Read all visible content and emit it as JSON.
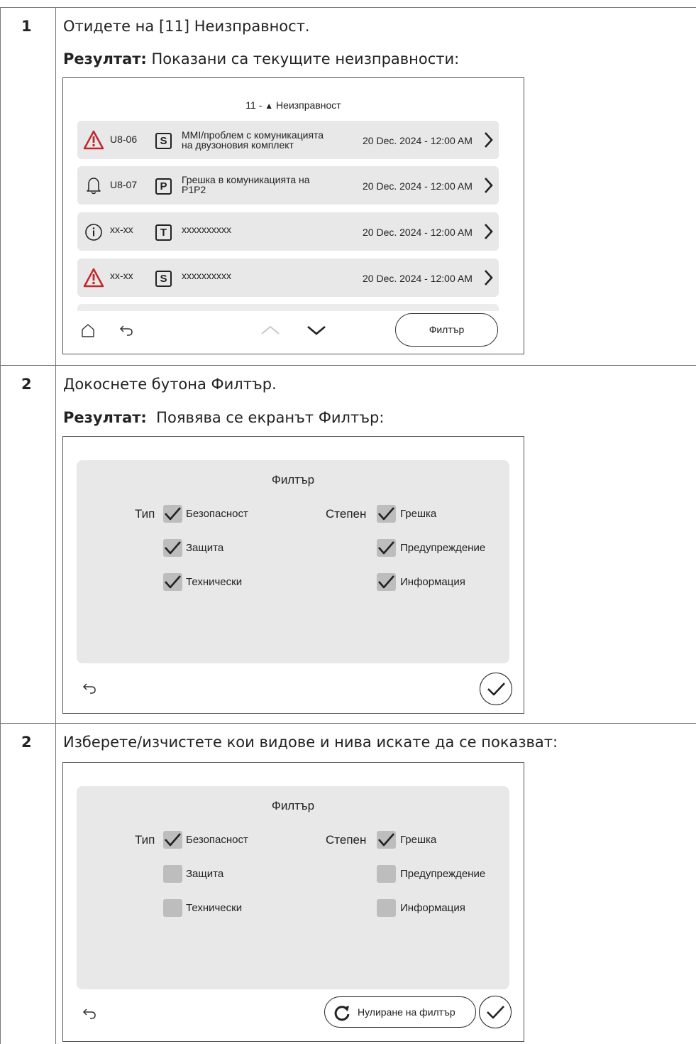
{
  "steps": [
    {
      "number": "1",
      "instruction_prefix": "Отидете на [11] ",
      "instruction_bold": "Неизправност",
      "instruction_suffix": ".",
      "result_label": "Резултат:",
      "result_text": " Показани са текущите неизправности:"
    },
    {
      "number": "2",
      "instruction_prefix": "Докоснете бутона ",
      "instruction_bold": "Филтър",
      "instruction_suffix": ".",
      "result_label": "Резултат:",
      "result_text": "  Появява се екранът ",
      "result_bold": "Филтър",
      "result_suffix": ":"
    },
    {
      "number": "2",
      "instruction": "Изберете/изчистете кои видове и нива искате да се показват:"
    }
  ],
  "malfunction_screen": {
    "title_prefix": "11 - ",
    "title_icon": "warning-triangle-icon",
    "title_text": "Неизправност",
    "rows": [
      {
        "icon": "warning-red-icon",
        "code": "U8-06",
        "badge": "S",
        "desc_line1": "MMI/проблем с комуникацията",
        "desc_line2": "на двузоновия комплект",
        "date": "20 Dec. 2024 - 12:00 AM"
      },
      {
        "icon": "bell-icon",
        "code": "U8-07",
        "badge": "P",
        "desc_line1": "Грешка в комуникацията на",
        "desc_line2": "P1P2",
        "date": "20 Dec. 2024 - 12:00 AM"
      },
      {
        "icon": "info-icon",
        "code": "xx-xx",
        "badge": "T",
        "desc_line1": "xxxxxxxxxx",
        "desc_line2": "",
        "date": "20 Dec. 2024 - 12:00 AM"
      },
      {
        "icon": "warning-red-icon",
        "code": "xx-xx",
        "badge": "S",
        "desc_line1": "xxxxxxxxxx",
        "desc_line2": "",
        "date": "20 Dec. 2024 - 12:00 AM"
      }
    ],
    "filter_button": "Филтър"
  },
  "filter_screen_1": {
    "title": "Филтър",
    "type_label": "Тип",
    "level_label": "Степен",
    "type_options": [
      {
        "label": "Безопасност",
        "checked": true
      },
      {
        "label": "Защита",
        "checked": true
      },
      {
        "label": "Технически",
        "checked": true
      }
    ],
    "level_options": [
      {
        "label": "Грешка",
        "checked": true
      },
      {
        "label": "Предупреждение",
        "checked": true
      },
      {
        "label": "Информация",
        "checked": true
      }
    ]
  },
  "filter_screen_2": {
    "title": "Филтър",
    "type_label": "Тип",
    "level_label": "Степен",
    "type_options": [
      {
        "label": "Безопасност",
        "checked": true
      },
      {
        "label": "Защита",
        "checked": false
      },
      {
        "label": "Технически",
        "checked": false
      }
    ],
    "level_options": [
      {
        "label": "Грешка",
        "checked": true
      },
      {
        "label": "Предупреждение",
        "checked": false
      },
      {
        "label": "Информация",
        "checked": false
      }
    ],
    "reset_button": "Нулиране на филтър"
  }
}
